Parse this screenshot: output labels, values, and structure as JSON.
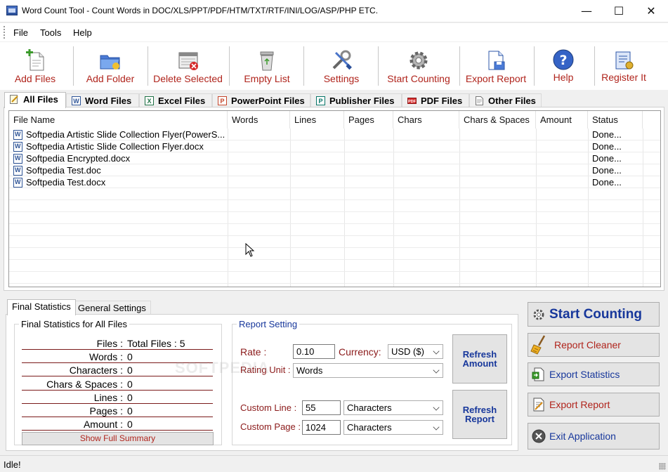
{
  "window": {
    "title": "Word Count Tool - Count Words in DOC/XLS/PPT/PDF/HTM/TXT/RTF/INI/LOG/ASP/PHP ETC.",
    "minimize": "—",
    "maximize": "☐",
    "close": "✕"
  },
  "menu": [
    "File",
    "Tools",
    "Help"
  ],
  "toolbar": {
    "add_files": "Add Files",
    "add_folder": "Add Folder",
    "delete_selected": "Delete Selected",
    "empty_list": "Empty List",
    "settings": "Settings",
    "start_counting": "Start Counting",
    "export_report": "Export Report",
    "help": "Help",
    "register": "Register It"
  },
  "file_tabs": [
    "All Files",
    "Word Files",
    "Excel Files",
    "PowerPoint Files",
    "Publisher Files",
    "PDF Files",
    "Other Files"
  ],
  "grid": {
    "columns": [
      "File Name",
      "Words",
      "Lines",
      "Pages",
      "Chars",
      "Chars & Spaces",
      "Amount",
      "Status"
    ],
    "rows": [
      {
        "name": "Softpedia Artistic Slide Collection Flyer(PowerS...",
        "status": "Done..."
      },
      {
        "name": "Softpedia Artistic Slide Collection Flyer.docx",
        "status": "Done..."
      },
      {
        "name": "Softpedia Encrypted.docx",
        "status": "Done..."
      },
      {
        "name": "Softpedia Test.doc",
        "status": "Done..."
      },
      {
        "name": "Softpedia Test.docx",
        "status": "Done..."
      }
    ]
  },
  "bottom_tabs": [
    "Final Statistics",
    "General Settings"
  ],
  "final_stats": {
    "caption": "Final Statistics for All Files",
    "rows": [
      {
        "key": "Files :",
        "value": "Total Files : 5"
      },
      {
        "key": "Words :",
        "value": "0"
      },
      {
        "key": "Characters :",
        "value": "0"
      },
      {
        "key": "Chars & Spaces :",
        "value": "0"
      },
      {
        "key": "Lines :",
        "value": "0"
      },
      {
        "key": "Pages :",
        "value": "0"
      },
      {
        "key": "Amount :",
        "value": "0"
      }
    ],
    "summary_button": "Show Full Summary"
  },
  "report": {
    "caption": "Report Setting",
    "rate_label": "Rate :",
    "rate_value": "0.10",
    "currency_label": "Currency:",
    "currency_value": "USD ($)",
    "rating_unit_label": "Rating Unit :",
    "rating_unit_value": "Words",
    "custom_line_label": "Custom Line :",
    "custom_line_value": "55",
    "custom_line_unit": "Characters",
    "custom_page_label": "Custom Page :",
    "custom_page_value": "1024",
    "custom_page_unit": "Characters",
    "refresh_amount": "Refresh\nAmount",
    "refresh_report": "Refresh\nReport"
  },
  "actions": {
    "start_counting": "Start Counting",
    "report_cleaner": "Report Cleaner",
    "export_statistics": "Export Statistics",
    "export_report": "Export Report",
    "exit": "Exit Application"
  },
  "status": "Idle!",
  "watermark": "SOFTPEDIA",
  "colors": {
    "accent_red": "#b0241c",
    "accent_blue": "#17379b",
    "stat_line": "#7a1a1a"
  }
}
